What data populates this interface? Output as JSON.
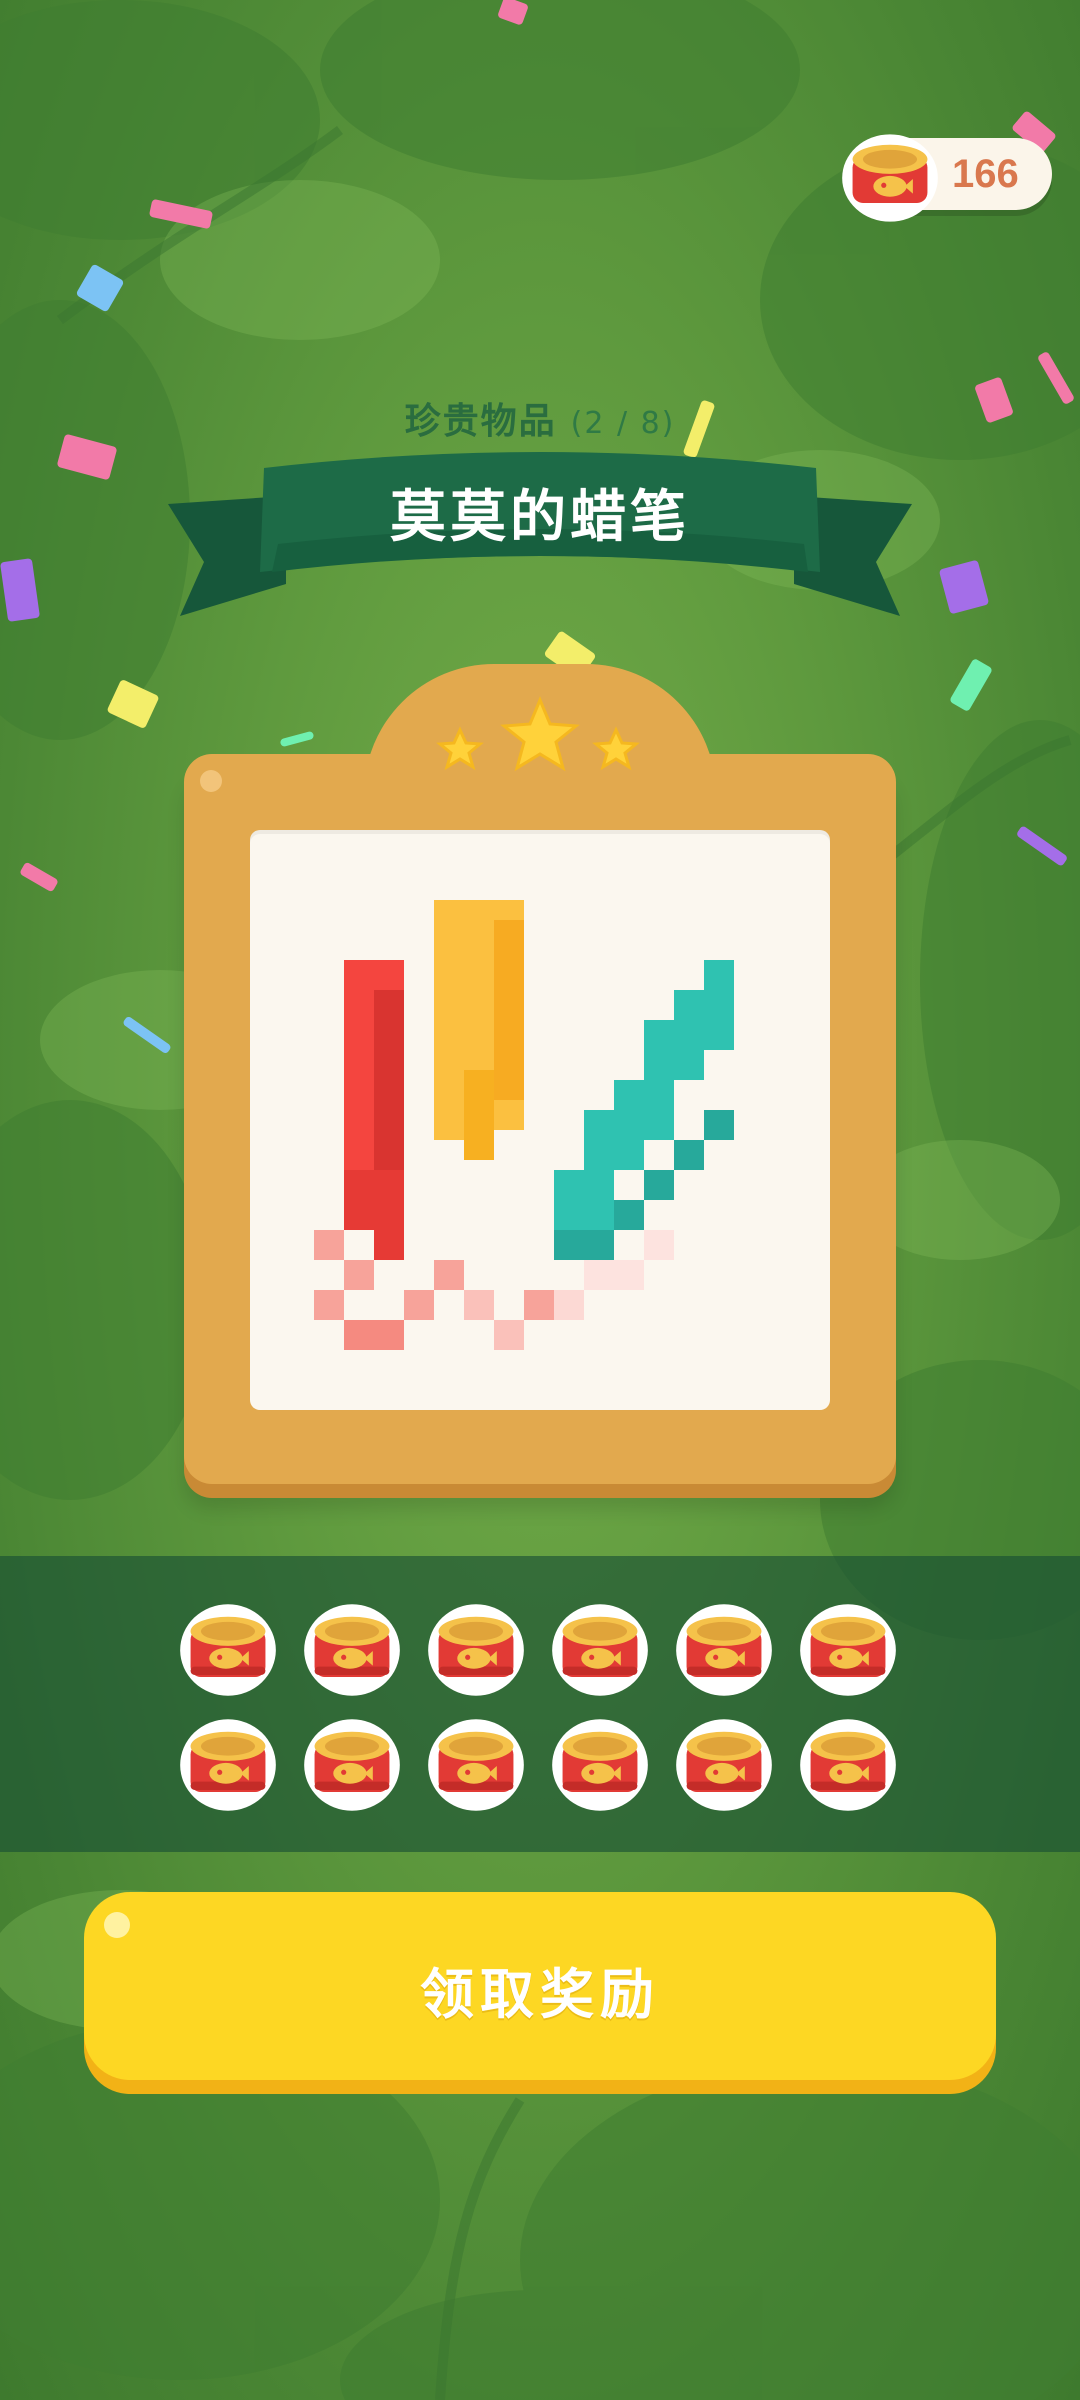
{
  "currency": {
    "icon": "cat-food-can-icon",
    "count": "166"
  },
  "collection": {
    "category_label": "珍贵物品",
    "progress": "(2 / 8)"
  },
  "item": {
    "title": "莫莫的蜡笔",
    "stars": 3,
    "image": "pixel-crayons-icon"
  },
  "rewards": {
    "icon": "cat-food-can-icon",
    "count": 12
  },
  "claim_button": {
    "label": "领取奖励"
  },
  "colors": {
    "background": "#5f9a3e",
    "ribbon": "#1d6b47",
    "frame": "#e2a94e",
    "button": "#fdd723",
    "star": "#ffd23a",
    "coin_text": "#d9784e"
  }
}
